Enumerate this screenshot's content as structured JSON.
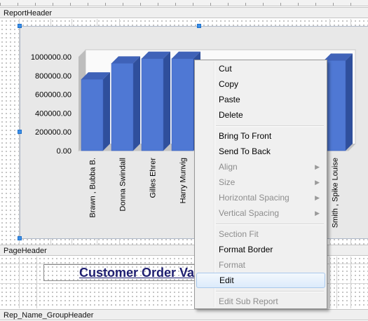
{
  "bands": {
    "report_header": "ReportHeader",
    "page_header": "PageHeader",
    "group_header": "Rep_Name_GroupHeader"
  },
  "title_text": "Customer Order Va",
  "chart_data": {
    "type": "bar",
    "title": "",
    "xlabel": "",
    "ylabel": "",
    "ylim": [
      0,
      1000000
    ],
    "y_ticks": [
      "1000000.00",
      "800000.00",
      "600000.00",
      "400000.00",
      "200000.00",
      "0.00"
    ],
    "categories": [
      "Brawn , Bubba B.",
      "Donna Swindall",
      "Gilles Ehrer",
      "Harry Munvig",
      "Smith , Spike Louise"
    ],
    "values": [
      760000,
      930000,
      980000,
      980000,
      960000
    ],
    "bar_color": "#4f78d4"
  },
  "context_menu": {
    "items": [
      {
        "label": "Cut",
        "enabled": true
      },
      {
        "label": "Copy",
        "enabled": true
      },
      {
        "label": "Paste",
        "enabled": true
      },
      {
        "label": "Delete",
        "enabled": true
      },
      {
        "label": "Bring To Front",
        "enabled": true
      },
      {
        "label": "Send To Back",
        "enabled": true
      },
      {
        "label": "Align",
        "enabled": false,
        "submenu": true
      },
      {
        "label": "Size",
        "enabled": false,
        "submenu": true
      },
      {
        "label": "Horizontal Spacing",
        "enabled": false,
        "submenu": true
      },
      {
        "label": "Vertical Spacing",
        "enabled": false,
        "submenu": true
      },
      {
        "label": "Section Fit",
        "enabled": false
      },
      {
        "label": "Format Border",
        "enabled": true
      },
      {
        "label": "Format",
        "enabled": false
      },
      {
        "label": "Edit",
        "enabled": true,
        "highlighted": true
      },
      {
        "label": "Edit Sub Report",
        "enabled": false
      }
    ],
    "submenu_arrow": "▶"
  }
}
